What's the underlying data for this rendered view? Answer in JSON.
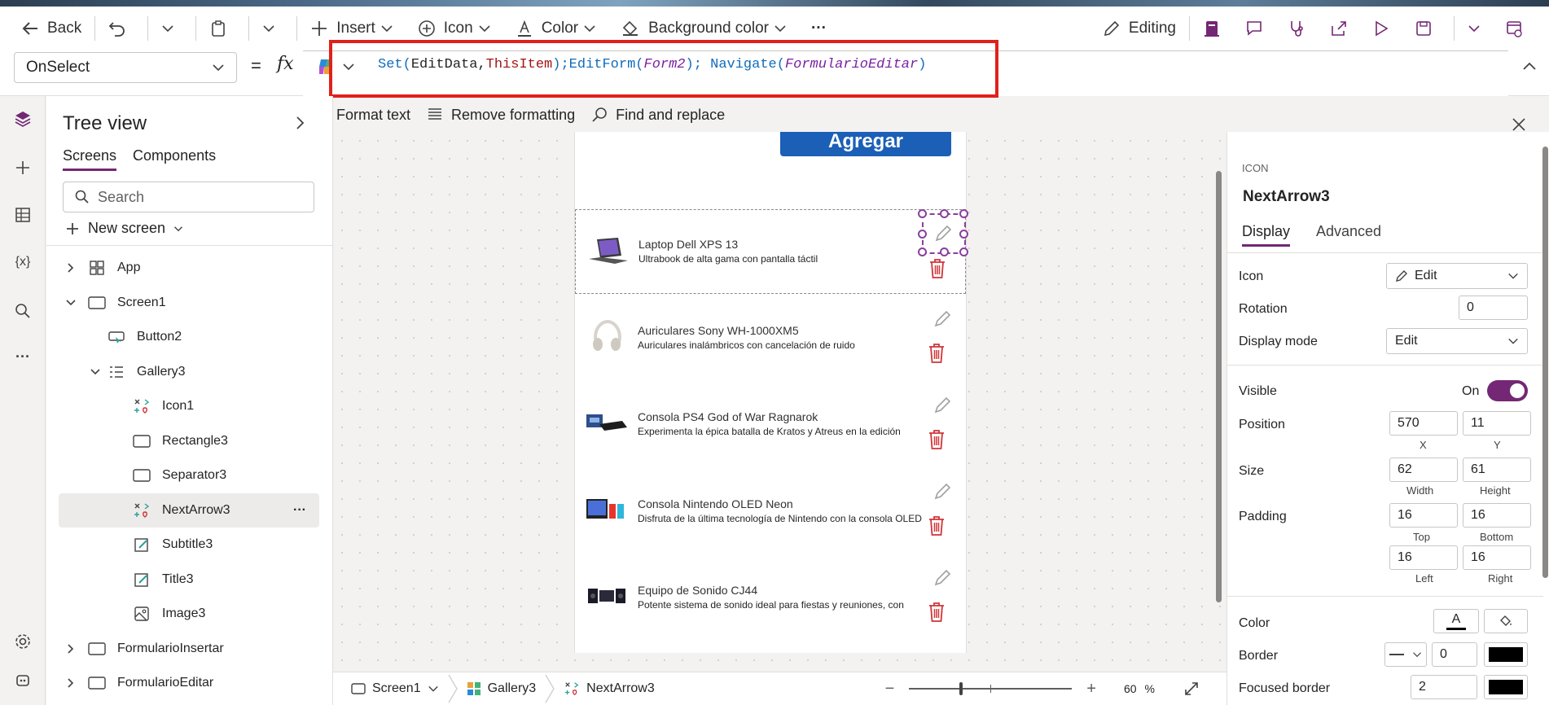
{
  "toolbar": {
    "back": "Back",
    "insert": "Insert",
    "icon": "Icon",
    "color": "Color",
    "background_color": "Background color",
    "more": "···",
    "editing": "Editing"
  },
  "formula": {
    "property": "OnSelect",
    "equals": "=",
    "fx": "fx",
    "tokens": {
      "t1": "Set(",
      "t2": "EditData",
      "t3": ",",
      "t4": "ThisItem",
      "t5": ");",
      "t6": "EditForm(",
      "t7": "Form2",
      "t8": ");",
      "t9": " Navigate(",
      "t10": "FormularioEditar",
      "t11": ")"
    }
  },
  "format_bar": {
    "format_text": "Format text",
    "remove_formatting": "Remove formatting",
    "find_replace": "Find and replace"
  },
  "tree": {
    "title": "Tree view",
    "tab_screens": "Screens",
    "tab_components": "Components",
    "search_placeholder": "Search",
    "new_screen": "New screen",
    "nodes": {
      "app": "App",
      "screen1": "Screen1",
      "button2": "Button2",
      "gallery3": "Gallery3",
      "icon1": "Icon1",
      "rectangle3": "Rectangle3",
      "separator3": "Separator3",
      "nextarrow3": "NextArrow3",
      "subtitle3": "Subtitle3",
      "title3": "Title3",
      "image3": "Image3",
      "formularioinsertar": "FormularioInsertar",
      "formularioeditar": "FormularioEditar"
    },
    "more_dots": "···"
  },
  "canvas": {
    "agregar": "Agregar",
    "items": [
      {
        "title": "Laptop Dell XPS 13",
        "subtitle": "Ultrabook de alta gama con pantalla táctil"
      },
      {
        "title": "Auriculares Sony WH-1000XM5",
        "subtitle": "Auriculares inalámbricos con cancelación de ruido"
      },
      {
        "title": "Consola PS4 God of War Ragnarok",
        "subtitle": "Experimenta la épica batalla de Kratos y Atreus en la edición"
      },
      {
        "title": "Consola Nintendo OLED Neon",
        "subtitle": "Disfruta de la última tecnología de Nintendo con la consola OLED"
      },
      {
        "title": "Equipo de Sonido CJ44",
        "subtitle": "Potente sistema de sonido ideal para fiestas y reuniones, con"
      }
    ]
  },
  "statusbar": {
    "screen": "Screen1",
    "gallery": "Gallery3",
    "control": "NextArrow3",
    "zoom": "60",
    "zoom_unit": "%"
  },
  "properties": {
    "type": "ICON",
    "name": "NextArrow3",
    "tab_display": "Display",
    "tab_advanced": "Advanced",
    "icon_label": "Icon",
    "icon_value": "Edit",
    "rotation_label": "Rotation",
    "rotation_value": "0",
    "display_mode_label": "Display mode",
    "display_mode_value": "Edit",
    "visible_label": "Visible",
    "visible_value": "On",
    "position_label": "Position",
    "x_value": "570",
    "y_value": "11",
    "x_label": "X",
    "y_label": "Y",
    "size_label": "Size",
    "width_value": "62",
    "height_value": "61",
    "width_label": "Width",
    "height_label": "Height",
    "padding_label": "Padding",
    "pad_top": "16",
    "pad_bottom": "16",
    "pad_left": "16",
    "pad_right": "16",
    "top_label": "Top",
    "bottom_label": "Bottom",
    "left_label": "Left",
    "right_label": "Right",
    "color_label": "Color",
    "color_glyph": "A",
    "border_label": "Border",
    "border_value": "0",
    "focused_border_label": "Focused border",
    "focused_border_value": "2"
  },
  "colors": {
    "accent": "#742774",
    "highlight_box": "#e0211b",
    "trash": "#d13438",
    "agregar_button": "#1b5fb7"
  }
}
